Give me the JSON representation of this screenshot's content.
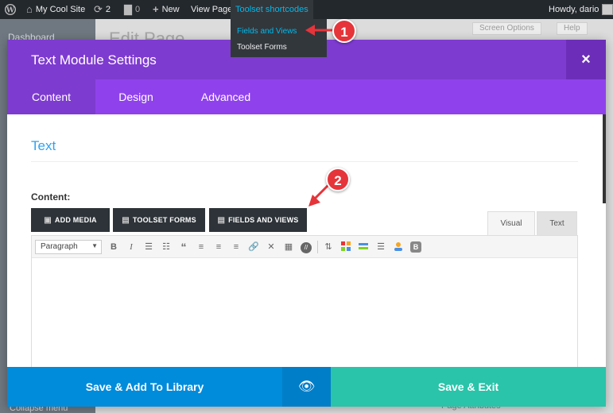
{
  "admin_bar": {
    "site_name": "My Cool Site",
    "updates_count": "2",
    "comments_count": "0",
    "new_label": "New",
    "view_page_label": "View Page",
    "toolset_label": "Toolset shortcodes",
    "greeting": "Howdy, dario"
  },
  "dropdown": {
    "items": [
      "Fields and Views",
      "Toolset Forms"
    ]
  },
  "background": {
    "sidebar_dashboard": "Dashboard",
    "page_title": "Edit Page",
    "screen_options": "Screen Options",
    "help": "Help",
    "page_attributes": "Page Attributes",
    "collapse_menu": "Collapse menu"
  },
  "modal": {
    "title": "Text Module Settings",
    "close": "×",
    "tabs": [
      "Content",
      "Design",
      "Advanced"
    ],
    "section_title": "Text",
    "content_label": "Content:",
    "buttons": {
      "add_media": "ADD MEDIA",
      "toolset_forms": "TOOLSET FORMS",
      "fields_views": "FIELDS AND VIEWS"
    },
    "editor_tabs": [
      "Visual",
      "Text"
    ],
    "format_value": "Paragraph"
  },
  "footer": {
    "save_library": "Save & Add To Library",
    "save_exit": "Save & Exit"
  },
  "annotations": [
    "1",
    "2"
  ],
  "colors": {
    "purple": "#7e3bd0",
    "purple_light": "#8f42ec",
    "blue": "#008bdb",
    "teal": "#29c4a9",
    "marker_red": "#e5343a"
  }
}
